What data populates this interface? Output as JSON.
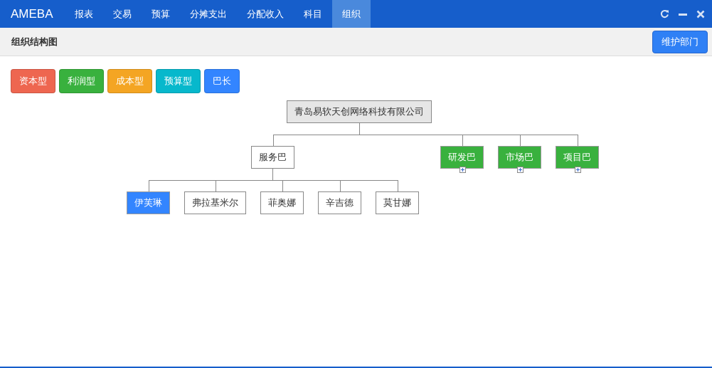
{
  "app": {
    "title": "AMEBA"
  },
  "nav": [
    {
      "label": "报表",
      "selected": false
    },
    {
      "label": "交易",
      "selected": false
    },
    {
      "label": "预算",
      "selected": false
    },
    {
      "label": "分摊支出",
      "selected": false
    },
    {
      "label": "分配收入",
      "selected": false
    },
    {
      "label": "科目",
      "selected": false
    },
    {
      "label": "组织",
      "selected": true
    }
  ],
  "page": {
    "title": "组织结构图",
    "action": "维护部门"
  },
  "legend": [
    {
      "label": "资本型",
      "color": "#ee6650"
    },
    {
      "label": "利润型",
      "color": "#39b13e"
    },
    {
      "label": "成本型",
      "color": "#f4a523"
    },
    {
      "label": "预算型",
      "color": "#07b8cc"
    },
    {
      "label": "巴长",
      "color": "#3385ff"
    }
  ],
  "tree": {
    "label": "青岛易软天创网络科技有限公司",
    "children": [
      {
        "label": "服务巴",
        "children": [
          {
            "label": "伊芙琳",
            "color": "#3385ff"
          },
          {
            "label": "弗拉基米尔"
          },
          {
            "label": "菲奥娜"
          },
          {
            "label": "辛吉德"
          },
          {
            "label": "莫甘娜"
          }
        ]
      },
      {
        "label": "研发巴",
        "color": "#39b13e",
        "collapsed": true
      },
      {
        "label": "市场巴",
        "color": "#39b13e",
        "collapsed": true
      },
      {
        "label": "项目巴",
        "color": "#39b13e",
        "collapsed": true
      }
    ]
  }
}
